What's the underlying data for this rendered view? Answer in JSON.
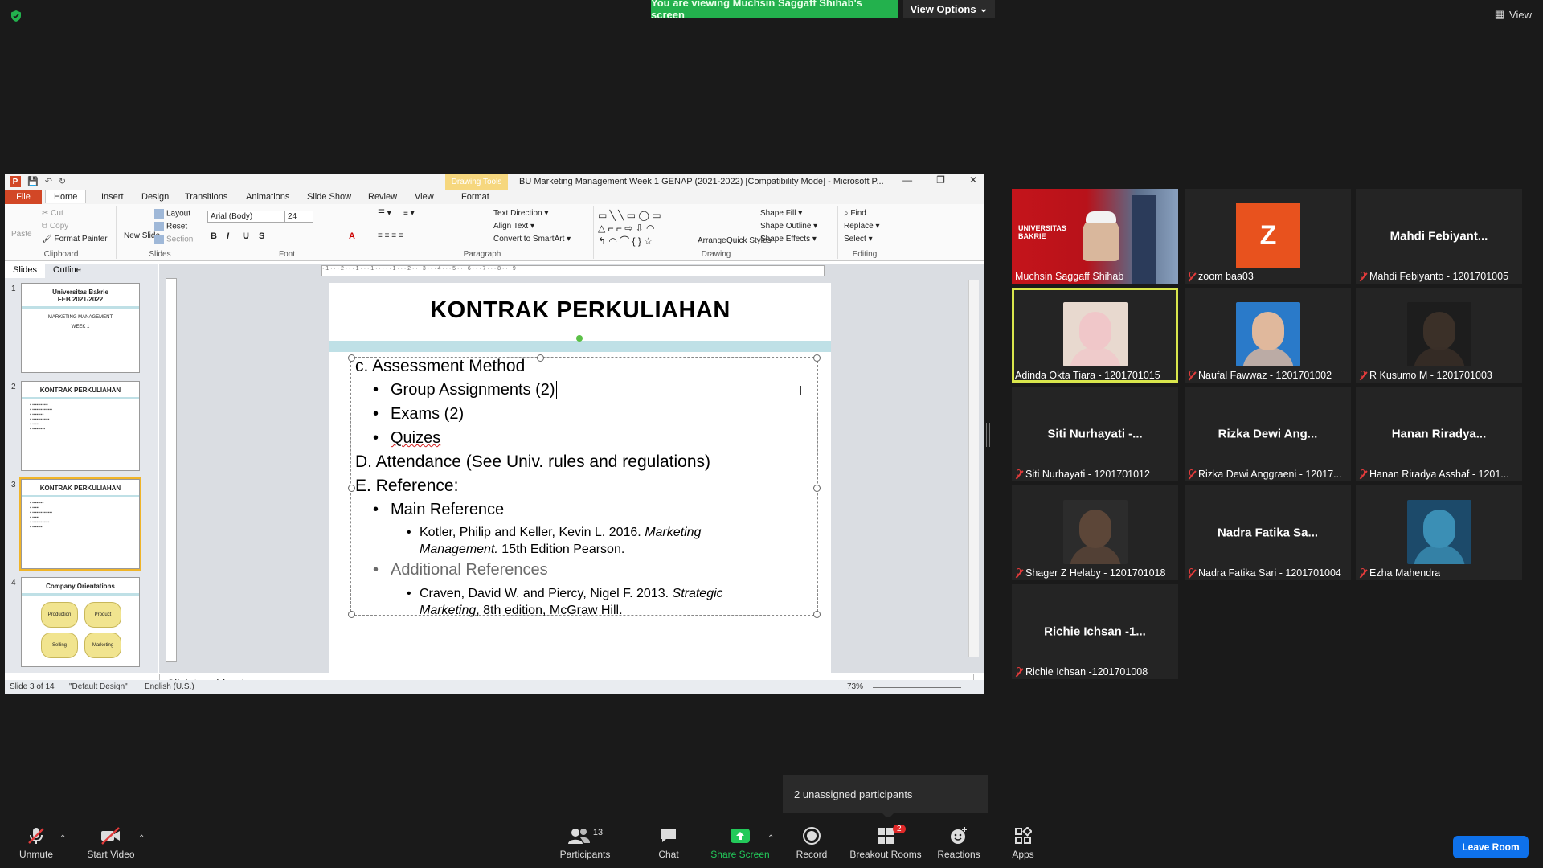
{
  "top": {
    "banner": "You are viewing Muchsin Saggaff Shihab's screen",
    "view_options": "View Options",
    "view": "View"
  },
  "ppt": {
    "caption": "BU Marketing Management Week 1 GENAP (2021-2022) [Compatibility Mode] - Microsoft P...",
    "drawing_tools": "Drawing Tools",
    "tabs": [
      "File",
      "Home",
      "Insert",
      "Design",
      "Transitions",
      "Animations",
      "Slide Show",
      "Review",
      "View",
      "Format"
    ],
    "ribbon": {
      "paste": "Paste",
      "cut": "Cut",
      "copy": "Copy",
      "format_painter": "Format Painter",
      "clipboard": "Clipboard",
      "new_slide": "New Slide",
      "layout": "Layout",
      "reset": "Reset",
      "section": "Section",
      "slides": "Slides",
      "font_name": "Arial (Body)",
      "font_size": "24",
      "font": "Font",
      "text_direction": "Text Direction",
      "align_text": "Align Text",
      "convert_smartart": "Convert to SmartArt",
      "paragraph": "Paragraph",
      "arrange": "Arrange",
      "quick_styles": "Quick Styles",
      "shape_fill": "Shape Fill",
      "shape_outline": "Shape Outline",
      "shape_effects": "Shape Effects",
      "drawing": "Drawing",
      "find": "Find",
      "replace": "Replace",
      "select": "Select",
      "editing": "Editing"
    },
    "pane_tabs": [
      "Slides",
      "Outline"
    ],
    "thumbs": [
      {
        "num": "1",
        "title": "Universitas Bakrie\nFEB 2021-2022",
        "sub": "MARKETING MANAGEMENT",
        "week": "WEEK 1"
      },
      {
        "num": "2",
        "title": "KONTRAK PERKULIAHAN"
      },
      {
        "num": "3",
        "title": "KONTRAK PERKULIAHAN"
      },
      {
        "num": "4",
        "title": "Company Orientations",
        "hex": [
          "Production",
          "Product",
          "Selling",
          "Marketing"
        ]
      }
    ],
    "slide": {
      "title": "KONTRAK PERKULIAHAN",
      "lines": [
        "c. Assessment Method",
        "Group Assignments  (2)",
        "Exams (2)",
        "Quizes",
        "D. Attendance (See Univ. rules and regulations)",
        "E. Reference:",
        "Main Reference",
        "Kotler, Philip and Keller, Kevin L. 2016. ",
        "Marketing",
        "Management.",
        " 15th Edition Pearson.",
        "Additional References",
        "Craven, David W. and Piercy, Nigel F. 2013. ",
        "Strategic",
        "Marketing",
        ", 8th edition, McGraw Hill."
      ]
    },
    "notes": "Click to add notes",
    "status": {
      "slide": "Slide 3 of 14",
      "design": "\"Default Design\"",
      "lang": "English (U.S.)",
      "zoom": "73%"
    }
  },
  "gallery": [
    {
      "name": "",
      "label": "Muchsin Saggaff Shihab",
      "muted": false,
      "kind": "video-host"
    },
    {
      "name": "",
      "label": "zoom baa03",
      "muted": true,
      "kind": "letter",
      "letter": "Z"
    },
    {
      "name": "Mahdi  Febiyant...",
      "label": "Mahdi Febiyanto - 1201701005",
      "muted": true,
      "kind": "text"
    },
    {
      "name": "",
      "label": "Adinda Okta Tiara - 1201701015",
      "muted": false,
      "kind": "photo",
      "active": true
    },
    {
      "name": "",
      "label": "Naufal Fawwaz - 1201701002",
      "muted": true,
      "kind": "photo"
    },
    {
      "name": "",
      "label": "R Kusumo M - 1201701003",
      "muted": true,
      "kind": "photo"
    },
    {
      "name": "Siti  Nurhayati -...",
      "label": "Siti Nurhayati - 1201701012",
      "muted": true,
      "kind": "text"
    },
    {
      "name": "Rizka Dewi Ang...",
      "label": "Rizka Dewi Anggraeni - 12017...",
      "muted": true,
      "kind": "text"
    },
    {
      "name": "Hanan  Riradya...",
      "label": "Hanan Riradya Asshaf - 1201...",
      "muted": true,
      "kind": "text"
    },
    {
      "name": "",
      "label": "Shager Z Helaby - 1201701018",
      "muted": true,
      "kind": "photo"
    },
    {
      "name": "Nadra Fatika Sa...",
      "label": "Nadra Fatika Sari - 1201701004",
      "muted": true,
      "kind": "text"
    },
    {
      "name": "",
      "label": "Ezha Mahendra",
      "muted": true,
      "kind": "photo"
    },
    {
      "name": "Richie  Ichsan  -1...",
      "label": "Richie Ichsan -1201701008",
      "muted": true,
      "kind": "text"
    }
  ],
  "host_overlay": "UNIVERSITAS BAKRIE",
  "unassigned": "2 unassigned participants",
  "footer": {
    "unmute": "Unmute",
    "start_video": "Start Video",
    "participants": "Participants",
    "participants_count": "13",
    "chat": "Chat",
    "share_screen": "Share Screen",
    "record": "Record",
    "breakout": "Breakout Rooms",
    "breakout_badge": "2",
    "reactions": "Reactions",
    "apps": "Apps",
    "leave": "Leave Room"
  },
  "colors": {
    "banner_green": "#23b14d",
    "active_speaker": "#d9e64c",
    "leave_blue": "#0e71eb",
    "ppt_orange": "#d24726"
  }
}
